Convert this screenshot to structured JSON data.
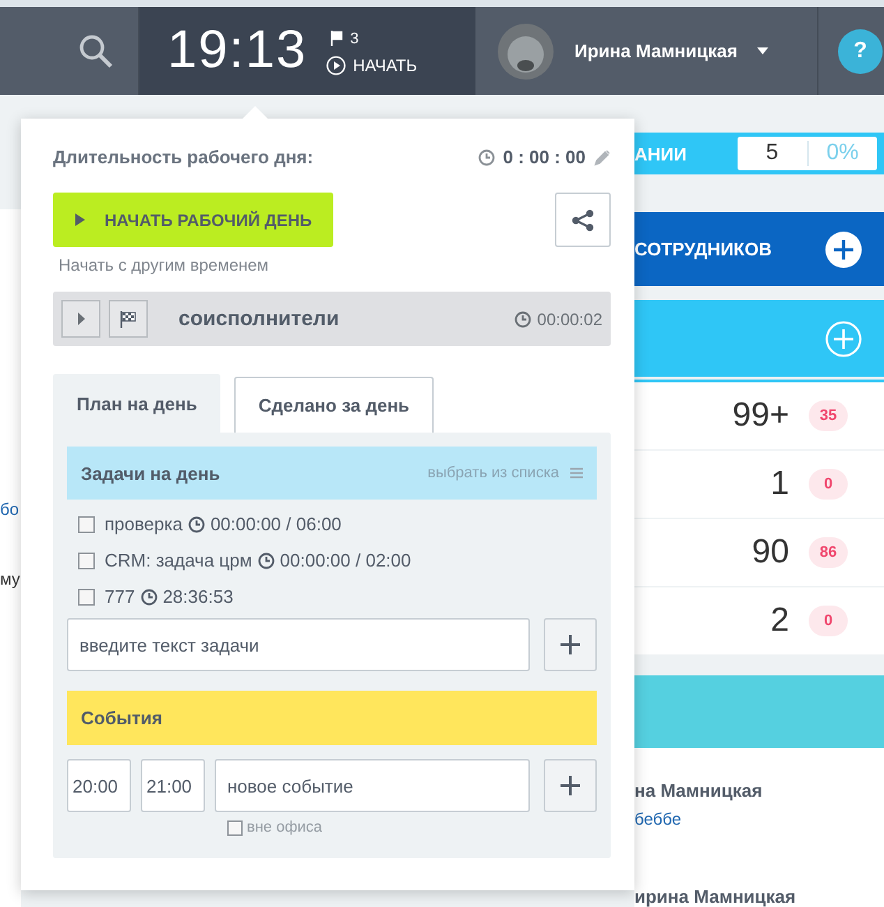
{
  "header": {
    "clock": "19:13",
    "flag_count": "3",
    "start_label": "НАЧАТЬ",
    "user_name": "Ирина Мамницкая",
    "help": "?"
  },
  "popup": {
    "duration_label": "Длительность рабочего дня:",
    "duration": "0 : 00 : 00",
    "start_button": "НАЧАТЬ РАБОЧИЙ ДЕНЬ",
    "start_other": "Начать с другим временем",
    "current_task": {
      "title": "соисполнители",
      "time": "00:00:02"
    },
    "tabs": [
      {
        "label": "План на день",
        "selected": true
      },
      {
        "label": "Сделано за день",
        "selected": false
      }
    ],
    "tasks_title": "Задачи на день",
    "tasks_link": "выбрать из списка",
    "tasks": [
      {
        "label": "проверка",
        "time": "00:00:00 / 06:00",
        "checked": false
      },
      {
        "label": "CRM: задача црм",
        "time": "00:00:00 / 02:00",
        "checked": false
      },
      {
        "label": "777",
        "time": "28:36:53",
        "checked": false
      }
    ],
    "task_input": {
      "placeholder": "введите текст задачи"
    },
    "events_title": "События",
    "event": {
      "start": "20:00",
      "end": "21:00",
      "placeholder": "новое событие"
    },
    "out_of_office": {
      "label": "вне офиса",
      "checked": false
    }
  },
  "left_fragments": [
    {
      "text": "бо",
      "kind": "link"
    },
    {
      "text": "му",
      "kind": "text"
    }
  ],
  "right": {
    "progress": {
      "label": "АНИИ",
      "count": "5",
      "percent": "0%"
    },
    "employees": "СОТРУДНИКОВ",
    "counters": [
      {
        "value": "99+",
        "badge": "35"
      },
      {
        "value": "1",
        "badge": "0"
      },
      {
        "value": "90",
        "badge": "86"
      },
      {
        "value": "2",
        "badge": "0"
      }
    ],
    "people": [
      {
        "name": "на Мамницкая",
        "link": "беббе"
      },
      {
        "name": "ирина Мамницкая"
      }
    ]
  }
}
